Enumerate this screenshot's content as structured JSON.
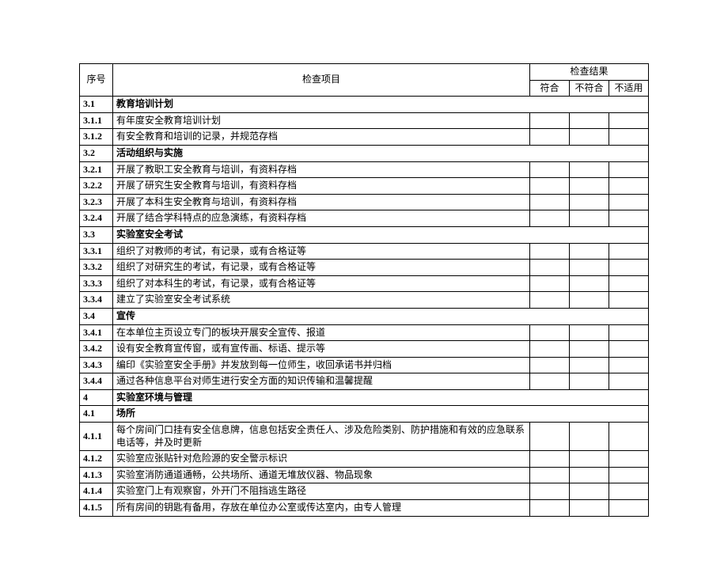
{
  "header": {
    "seq": "序号",
    "item": "检查项目",
    "result": "检查结果",
    "pass": "符合",
    "fail": "不符合",
    "na": "不适用"
  },
  "rows": [
    {
      "num": "3.1",
      "text": "教育培训计划",
      "section": true
    },
    {
      "num": "3.1.1",
      "text": "有年度安全教育培训计划"
    },
    {
      "num": "3.1.2",
      "text": "有安全教育和培训的记录，并规范存档"
    },
    {
      "num": "3.2",
      "text": "活动组织与实施",
      "section": true
    },
    {
      "num": "3.2.1",
      "text": "开展了教职工安全教育与培训，有资料存档"
    },
    {
      "num": "3.2.2",
      "text": "开展了研究生安全教育与培训，有资料存档"
    },
    {
      "num": "3.2.3",
      "text": "开展了本科生安全教育与培训，有资料存档"
    },
    {
      "num": "3.2.4",
      "text": "开展了结合学科特点的应急演练，有资料存档"
    },
    {
      "num": "3.3",
      "text": "实验室安全考试",
      "section": true
    },
    {
      "num": "3.3.1",
      "text": "组织了对教师的考试，有记录，或有合格证等"
    },
    {
      "num": "3.3.2",
      "text": "组织了对研究生的考试，有记录，或有合格证等"
    },
    {
      "num": "3.3.3",
      "text": "组织了对本科生的考试，有记录，或有合格证等"
    },
    {
      "num": "3.3.4",
      "text": "建立了实验室安全考试系统"
    },
    {
      "num": "3.4",
      "text": "宣传",
      "section": true
    },
    {
      "num": "3.4.1",
      "text": "在本单位主页设立专门的板块开展安全宣传、报道"
    },
    {
      "num": "3.4.2",
      "text": "设有安全教育宣传窗，或有宣传画、标语、提示等"
    },
    {
      "num": "3.4.3",
      "text": "编印《实验室安全手册》并发放到每一位师生，收回承诺书并归档"
    },
    {
      "num": "3.4.4",
      "text": "通过各种信息平台对师生进行安全方面的知识传输和温馨提醒"
    },
    {
      "num": "4",
      "text": "实验室环境与管理",
      "section": true
    },
    {
      "num": "4.1",
      "text": "场所",
      "section": true
    },
    {
      "num": "4.1.1",
      "text": "每个房间门口挂有安全信息牌，信息包括安全责任人、涉及危险类别、防护措施和有效的应急联系电话等，并及时更新"
    },
    {
      "num": "4.1.2",
      "text": "实验室应张贴针对危险源的安全警示标识"
    },
    {
      "num": "4.1.3",
      "text": "实验室消防通道通畅，公共场所、通道无堆放仪器、物品现象"
    },
    {
      "num": "4.1.4",
      "text": "实验室门上有观察窗，外开门不阻挡逃生路径"
    },
    {
      "num": "4.1.5",
      "text": "所有房间的钥匙有备用，存放在单位办公室或传达室内，由专人管理"
    }
  ]
}
